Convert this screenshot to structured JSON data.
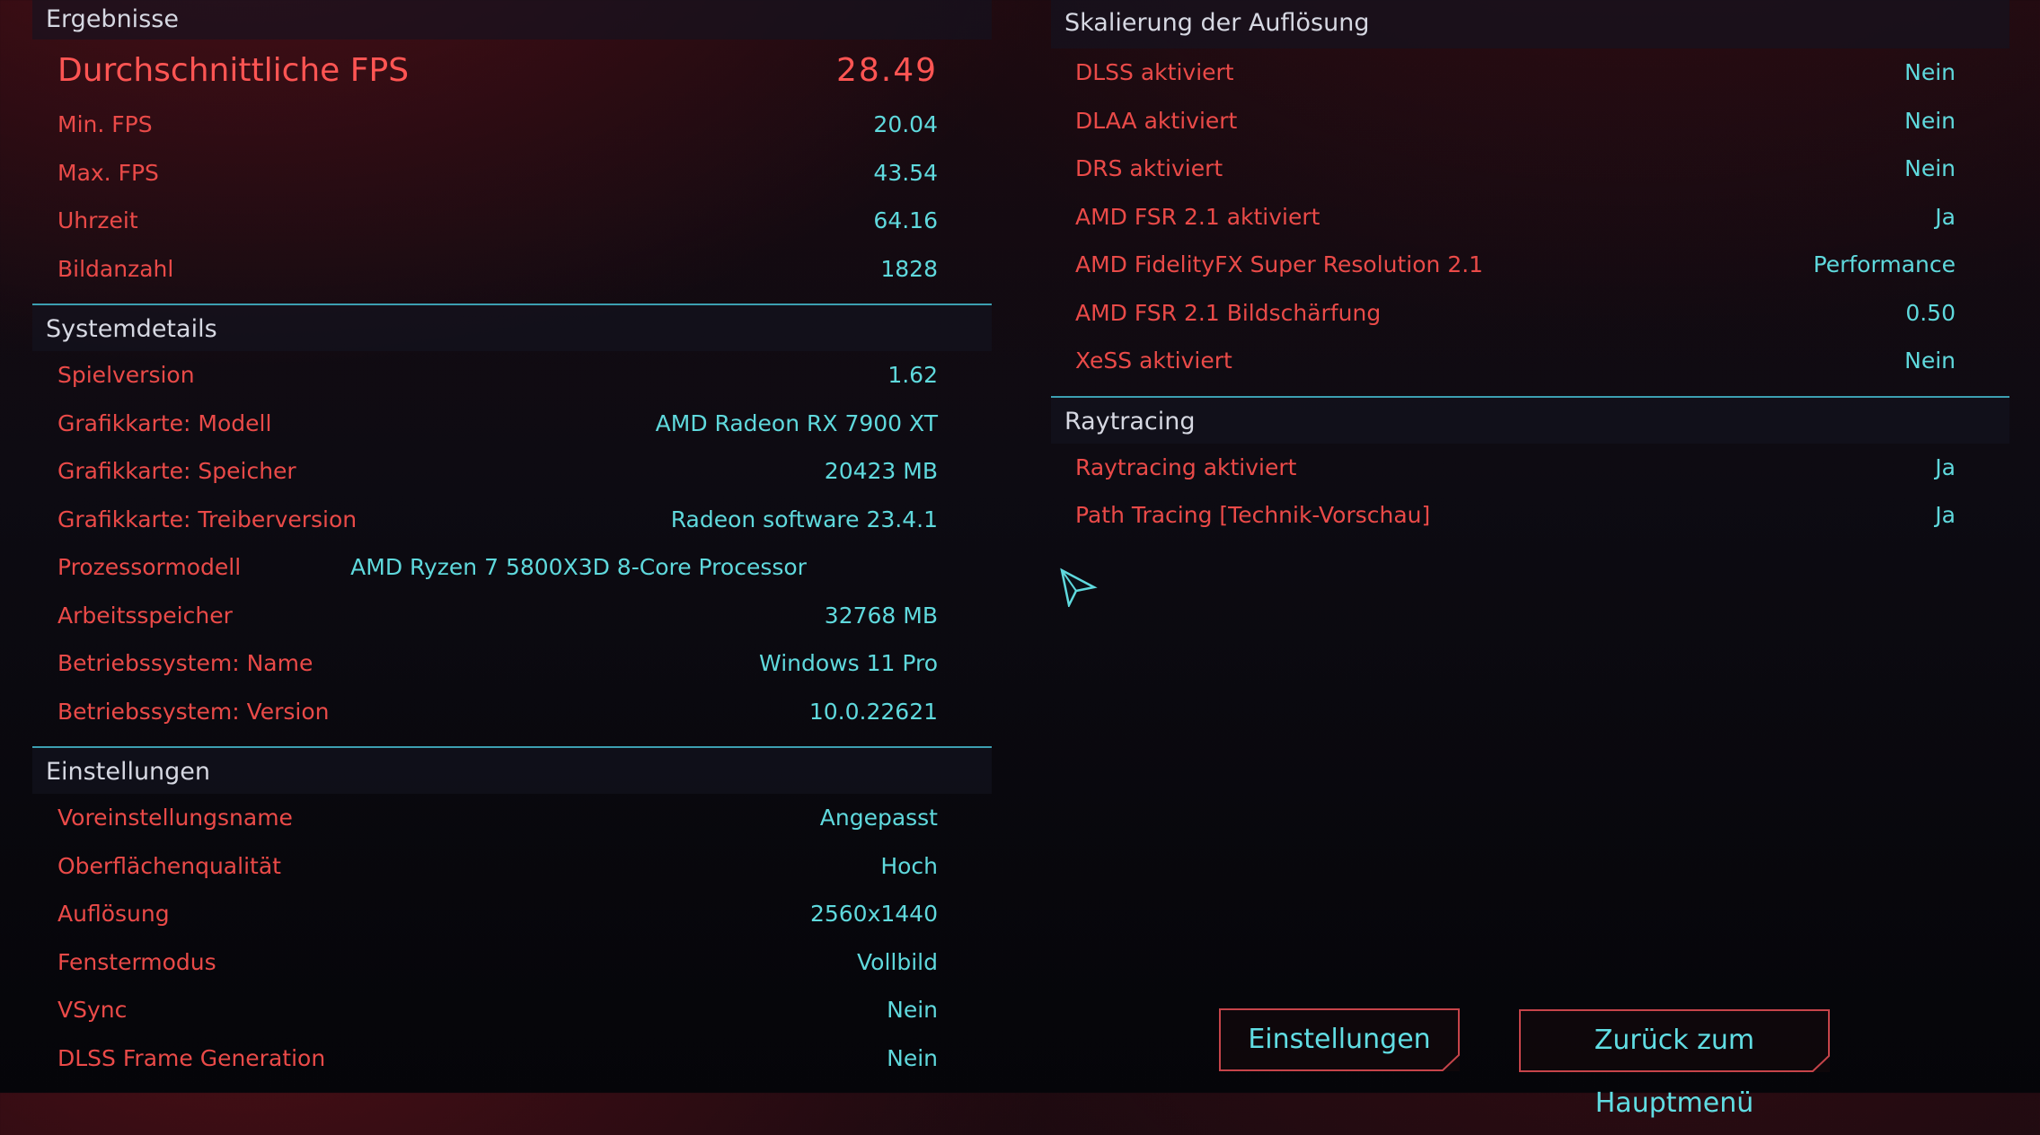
{
  "results": {
    "header": "Ergebnisse",
    "avg_fps": {
      "label": "Durchschnittliche FPS",
      "value": "28.49"
    },
    "rows": [
      {
        "label": "Min. FPS",
        "value": "20.04"
      },
      {
        "label": "Max. FPS",
        "value": "43.54"
      },
      {
        "label": "Uhrzeit",
        "value": "64.16"
      },
      {
        "label": "Bildanzahl",
        "value": "1828"
      }
    ]
  },
  "system": {
    "header": "Systemdetails",
    "rows": [
      {
        "label": "Spielversion",
        "value": "1.62"
      },
      {
        "label": "Grafikkarte: Modell",
        "value": "AMD Radeon RX 7900 XT"
      },
      {
        "label": "Grafikkarte: Speicher",
        "value": "20423 MB"
      },
      {
        "label": "Grafikkarte: Treiberversion",
        "value": "Radeon software 23.4.1"
      },
      {
        "label": "Prozessormodell",
        "value": "AMD Ryzen 7 5800X3D 8-Core Processor"
      },
      {
        "label": "Arbeitsspeicher",
        "value": "32768 MB"
      },
      {
        "label": "Betriebssystem: Name",
        "value": "Windows 11 Pro"
      },
      {
        "label": "Betriebssystem: Version",
        "value": "10.0.22621"
      }
    ]
  },
  "settings": {
    "header": "Einstellungen",
    "rows": [
      {
        "label": "Voreinstellungsname",
        "value": "Angepasst"
      },
      {
        "label": "Oberflächenqualität",
        "value": "Hoch"
      },
      {
        "label": "Auflösung",
        "value": "2560x1440"
      },
      {
        "label": "Fenstermodus",
        "value": "Vollbild"
      },
      {
        "label": "VSync",
        "value": "Nein"
      },
      {
        "label": "DLSS Frame Generation",
        "value": "Nein"
      }
    ]
  },
  "scaling": {
    "header": "Skalierung der Auflösung",
    "rows": [
      {
        "label": "DLSS aktiviert",
        "value": "Nein"
      },
      {
        "label": "DLAA aktiviert",
        "value": "Nein"
      },
      {
        "label": "DRS aktiviert",
        "value": "Nein"
      },
      {
        "label": "AMD FSR 2.1 aktiviert",
        "value": "Ja"
      },
      {
        "label": "AMD FidelityFX Super Resolution 2.1",
        "value": "Performance"
      },
      {
        "label": "AMD FSR 2.1 Bildschärfung",
        "value": "0.50"
      },
      {
        "label": "XeSS aktiviert",
        "value": "Nein"
      }
    ]
  },
  "raytracing": {
    "header": "Raytracing",
    "rows": [
      {
        "label": "Raytracing aktiviert",
        "value": "Ja"
      },
      {
        "label": "Path Tracing [Technik-Vorschau]",
        "value": "Ja"
      }
    ]
  },
  "buttons": {
    "settings": "Einstellungen",
    "back": "Zurück zum Hauptmenü"
  },
  "icons": {
    "cursor": "mouse-pointer-icon"
  },
  "colors": {
    "label_red": "#ea4a48",
    "value_cyan": "#5fd9dd",
    "divider_cyan": "#3c9fb1",
    "header_text": "#d6d8e2"
  }
}
